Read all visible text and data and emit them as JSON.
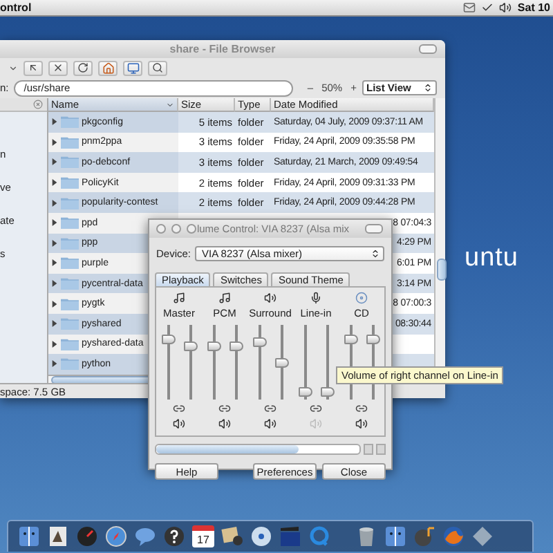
{
  "menu_bar": {
    "app_title": "ontrol",
    "clock": "Sat 10"
  },
  "desktop": {
    "logo_text": "untu"
  },
  "file_browser": {
    "title": "share - File Browser",
    "location_label": "n:",
    "location": "/usr/share",
    "zoom_out": "–",
    "zoom": "50%",
    "zoom_in": "+",
    "view": "List View",
    "sidebar_groups": [
      [
        "n",
        "ve",
        "ate"
      ],
      [
        "s"
      ]
    ],
    "columns": [
      {
        "label": "Name",
        "sorted": true
      },
      {
        "label": "Size",
        "sorted": false
      },
      {
        "label": "Type",
        "sorted": false
      },
      {
        "label": "Date Modified",
        "sorted": false
      }
    ],
    "rows": [
      {
        "name": "pkgconfig",
        "size": "5 items",
        "type": "folder",
        "date": "Saturday, 04 July, 2009 09:37:11 AM"
      },
      {
        "name": "pnm2ppa",
        "size": "3 items",
        "type": "folder",
        "date": "Friday, 24 April, 2009 09:35:58 PM"
      },
      {
        "name": "po-debconf",
        "size": "3 items",
        "type": "folder",
        "date": "Saturday, 21 March, 2009 09:49:54"
      },
      {
        "name": "PolicyKit",
        "size": "2 items",
        "type": "folder",
        "date": "Friday, 24 April, 2009 09:31:33 PM"
      },
      {
        "name": "popularity-contest",
        "size": "2 items",
        "type": "folder",
        "date": "Friday, 24 April, 2009 09:44:28 PM"
      },
      {
        "name": "ppd",
        "date": "8 07:04:3"
      },
      {
        "name": "ppp",
        "date": "4:29 PM"
      },
      {
        "name": "purple",
        "date": "6:01 PM"
      },
      {
        "name": "pycentral-data",
        "date": "3:14 PM"
      },
      {
        "name": "pygtk",
        "date": "8 07:00:3"
      },
      {
        "name": "pyshared",
        "date": "08:30:44"
      },
      {
        "name": "pyshared-data"
      },
      {
        "name": "python"
      }
    ],
    "status": "space: 7.5 GB"
  },
  "volume_control": {
    "title": "lume Control: VIA 8237 (Alsa mix",
    "device_label": "Device:",
    "device": "VIA 8237 (Alsa mixer)",
    "tabs": [
      {
        "label": "Playback",
        "selected": true
      },
      {
        "label": "Switches",
        "selected": false
      },
      {
        "label": "Sound Theme",
        "selected": false
      }
    ],
    "channels": [
      {
        "name": "Master",
        "kind": "music",
        "muted": false,
        "sliders": [
          {
            "level": 0.85
          },
          {
            "level": 0.75
          }
        ]
      },
      {
        "name": "PCM",
        "kind": "music",
        "muted": false,
        "sliders": [
          {
            "level": 0.75
          },
          {
            "level": 0.75
          }
        ]
      },
      {
        "name": "Surround",
        "kind": "speaker",
        "muted": false,
        "sliders": [
          {
            "level": 0.8
          },
          {
            "level": 0.5
          }
        ]
      },
      {
        "name": "Line-in",
        "kind": "mic",
        "muted": true,
        "sliders": [
          {
            "level": 0.05
          },
          {
            "level": 0.05
          }
        ]
      },
      {
        "name": "CD",
        "kind": "disc",
        "muted": false,
        "sliders": [
          {
            "level": 0.85
          },
          {
            "level": 0.85
          }
        ]
      }
    ],
    "buttons": [
      "Help",
      "Preferences",
      "Close"
    ]
  },
  "tooltip": "Volume of right channel on Line-in",
  "dock": {
    "calendar_day": "17"
  }
}
